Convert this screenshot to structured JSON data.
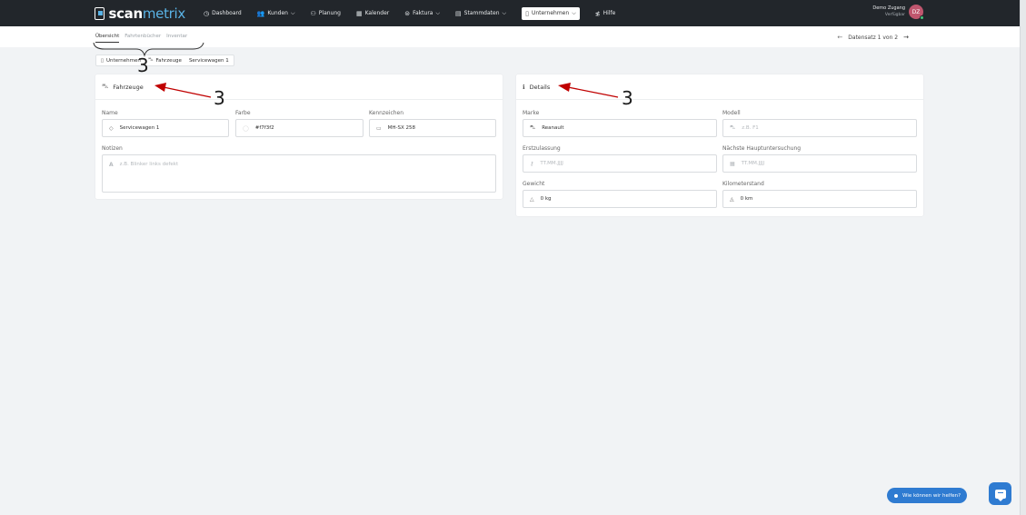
{
  "brand": {
    "part1": "scan",
    "part2": "metrix"
  },
  "nav": [
    {
      "label": "Dashboard",
      "icon": "◷",
      "chevron": ""
    },
    {
      "label": "Kunden",
      "icon": "👥",
      "chevron": "⌵"
    },
    {
      "label": "Planung",
      "icon": "⚇",
      "chevron": ""
    },
    {
      "label": "Kalender",
      "icon": "▦",
      "chevron": ""
    },
    {
      "label": "Faktura",
      "icon": "⊜",
      "chevron": "⌵"
    },
    {
      "label": "Stammdaten",
      "icon": "▤",
      "chevron": "⌵"
    },
    {
      "label": "Unternehmen",
      "icon": "▯",
      "chevron": "⌵"
    },
    {
      "label": "Hilfe",
      "icon": "≴",
      "chevron": ""
    }
  ],
  "user": {
    "name": "Demo Zugang",
    "status": "Verfügbar",
    "initials": "DZ"
  },
  "tabs": [
    "Übersicht",
    "Fahrtenbücher",
    "Inventar"
  ],
  "record_nav": {
    "text": "Datensatz 1 von 2",
    "prev": "←",
    "next": "→"
  },
  "breadcrumb": [
    "Unternehmen",
    "Fahrzeuge",
    "Servicewagen 1"
  ],
  "vehicle": {
    "title": "Fahrzeuge",
    "name_label": "Name",
    "name_value": "Servicewagen 1",
    "color_label": "Farbe",
    "color_value": "#f7f3f2",
    "plate_label": "Kennzeichen",
    "plate_value": "MH-SX 258",
    "notes_label": "Notizen",
    "notes_placeholder": "z.B. Blinker links defekt"
  },
  "details": {
    "title": "Details",
    "brand_label": "Marke",
    "brand_value": "Reanault",
    "model_label": "Modell",
    "model_placeholder": "z.B. F1",
    "reg_label": "Erstzulassung",
    "reg_placeholder": "TT.MM.JJJJ",
    "inspection_label": "Nächste Hauptuntersuchung",
    "inspection_placeholder": "TT.MM.JJJJ",
    "weight_label": "Gewicht",
    "weight_value": "0 kg",
    "mileage_label": "Kilometerstand",
    "mileage_value": "0 km"
  },
  "annotations": {
    "n1": "3",
    "n2": "3",
    "n3": "3",
    "color": "#c00000"
  },
  "help": {
    "label": "Wie können wir helfen?"
  }
}
